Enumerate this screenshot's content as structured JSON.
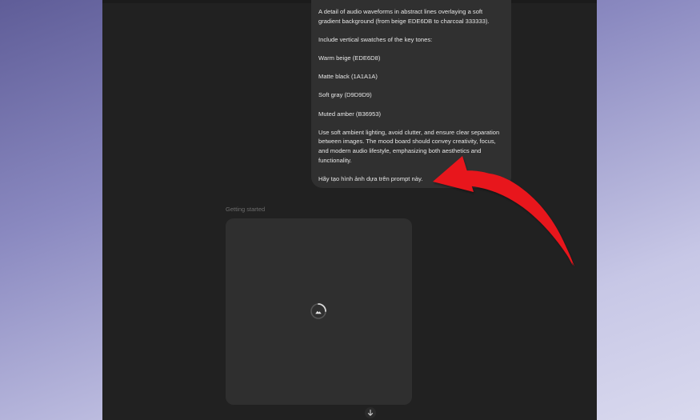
{
  "chat": {
    "prompt_paragraphs": [
      "A detail of audio waveforms in abstract lines overlaying a soft gradient background (from beige EDE6DB to charcoal 333333).",
      "Include vertical swatches of the key tones:",
      "Warm beige (EDE6D8)",
      "Matte black (1A1A1A)",
      "Soft gray (D9D9D9)",
      "Muted amber (B36953)",
      "Use soft ambient lighting, avoid clutter, and ensure clear separation between images. The mood board should convey creativity, focus, and modern audio lifestyle, emphasizing both aesthetics and functionality.",
      "Hãy tạo hình ảnh dựa trên prompt này."
    ],
    "status_text": "Getting started",
    "image_placeholder_icon": "image-loading-icon",
    "scroll_icon": "arrow-down-icon"
  },
  "annotation": {
    "arrow_color": "#e8141c",
    "icon": "curved-arrow-icon"
  },
  "colors": {
    "window_bg": "#212121",
    "bubble_bg": "#303030",
    "card_bg": "#2f2f2f"
  }
}
